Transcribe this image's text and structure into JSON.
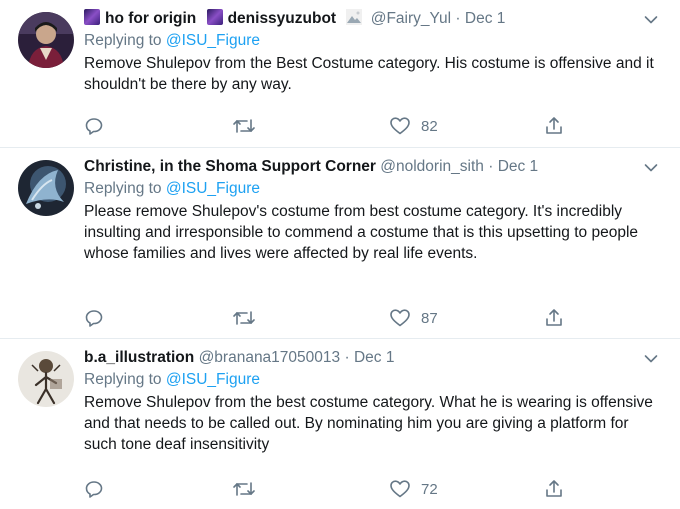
{
  "tweets": [
    {
      "name_a": "ho for origin",
      "name_b": "denissyuzubot",
      "handle": "@Fairy_Yul",
      "separator": "·",
      "date": "Dec 1",
      "replying_prefix": "Replying to",
      "replying_to": "@ISU_Figure",
      "text": "Remove Shulepov from the Best Costume category. His costume is offensive and it shouldn't be there by any way.",
      "likes": "82"
    },
    {
      "name": "Christine, in the Shoma Support Corner",
      "handle": "@noldorin_sith",
      "separator": "·",
      "date": "Dec 1",
      "replying_prefix": "Replying to",
      "replying_to": "@ISU_Figure",
      "text": "Please remove Shulepov's costume from best costume category. It's incredibly insulting and irresponsible to commend a costume that is this upsetting to people whose families and lives were affected by real life events.",
      "likes": "87"
    },
    {
      "name": "b.a_illustration",
      "handle": "@branana17050013",
      "separator": "·",
      "date": "Dec 1",
      "replying_prefix": "Replying to",
      "replying_to": "@ISU_Figure",
      "text": "Remove Shulepov from the best costume category. What he is wearing is offensive and that needs to be called out. By nominating him you are giving a platform for such tone deaf insensitivity",
      "likes": "72"
    }
  ],
  "icons": {
    "reply": "reply-icon",
    "retweet": "retweet-icon",
    "like": "heart-icon",
    "share": "share-icon",
    "menu": "chevron-down-icon"
  },
  "colors": {
    "link": "#1da1f2",
    "secondary_text": "#657786",
    "divider": "#e6ecf0",
    "galaxy_emoji": "#5b2a86"
  }
}
